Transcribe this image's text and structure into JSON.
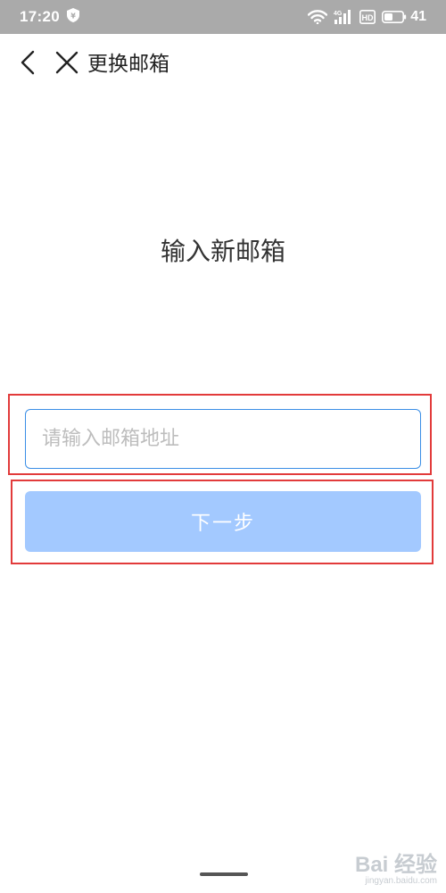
{
  "status_bar": {
    "time": "17:20",
    "battery_level": "41",
    "network_label": "4G",
    "hd_label": "HD",
    "icons": [
      "shield-icon",
      "wifi-icon",
      "signal-icon",
      "hd-icon",
      "battery-icon"
    ]
  },
  "nav": {
    "title": "更换邮箱",
    "back_icon": "chevron-left-icon",
    "close_icon": "close-icon"
  },
  "main": {
    "heading": "输入新邮箱",
    "email_input": {
      "value": "",
      "placeholder": "请输入邮箱地址"
    },
    "next_button_label": "下一步"
  },
  "watermark": {
    "main": "Bai 经验",
    "sub": "jingyan.baidu.com"
  },
  "colors": {
    "status_bar_bg": "#aaaaaa",
    "input_border": "#3a8ee6",
    "button_bg_disabled": "#a3c9ff",
    "highlight_border": "#e23b3b",
    "placeholder": "#bdbdbd"
  }
}
